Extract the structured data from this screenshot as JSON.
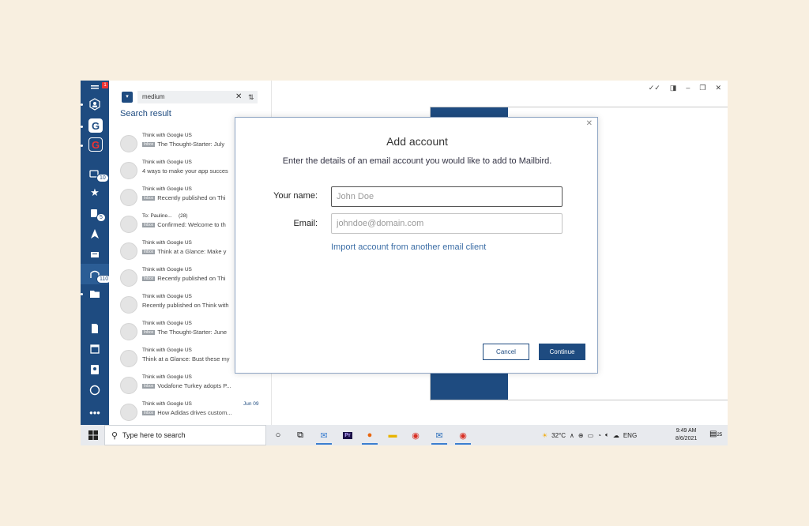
{
  "rail": {
    "notification_badge": "1",
    "badge_1": "10",
    "badge_2": "5",
    "badge_3": "110"
  },
  "search": {
    "query": "medium",
    "title": "Search result",
    "results": [
      {
        "sender": "Think with Google US",
        "tag": "Inbox",
        "subject": "The Thought-Starter: July",
        "count": "",
        "date": ""
      },
      {
        "sender": "Think with Google US",
        "tag": "",
        "subject": "4 ways to make your app succes",
        "count": "",
        "date": ""
      },
      {
        "sender": "Think with Google US",
        "tag": "Inbox",
        "subject": "Recently published on Thi",
        "count": "",
        "date": ""
      },
      {
        "sender": "To: Pauline...",
        "tag": "Inbox",
        "subject": "Confirmed: Welcome to th",
        "count": "(28)",
        "date": ""
      },
      {
        "sender": "Think with Google US",
        "tag": "Inbox",
        "subject": "Think at a Glance: Make y",
        "count": "",
        "date": ""
      },
      {
        "sender": "Think with Google US",
        "tag": "Inbox",
        "subject": "Recently published on Thi",
        "count": "",
        "date": ""
      },
      {
        "sender": "Think with Google US",
        "tag": "",
        "subject": "Recently published on Think with",
        "count": "",
        "date": ""
      },
      {
        "sender": "Think with Google US",
        "tag": "Inbox",
        "subject": "The Thought-Starter: June",
        "count": "",
        "date": ""
      },
      {
        "sender": "Think with Google US",
        "tag": "",
        "subject": "Think at a Glance: Bust these my",
        "count": "",
        "date": ""
      },
      {
        "sender": "Think with Google US",
        "tag": "Inbox",
        "subject": "Vodafone Turkey adopts P...",
        "count": "",
        "date": ""
      },
      {
        "sender": "Think with Google US",
        "tag": "Inbox",
        "subject": "How Adidas drives custom...",
        "count": "",
        "date": "Jun 09"
      }
    ]
  },
  "dialog": {
    "title": "Add account",
    "subtitle": "Enter the details of an email account you would like to add to Mailbird.",
    "name_label": "Your name:",
    "name_placeholder": "John Doe",
    "email_label": "Email:",
    "email_placeholder": "johndoe@domain.com",
    "import_link": "Import account from another email client",
    "cancel_label": "Cancel",
    "continue_label": "Continue"
  },
  "taskbar": {
    "search_placeholder": "Type here to search",
    "temperature": "32°C",
    "language": "ENG",
    "time": "9:49 AM",
    "date": "8/6/2021",
    "notification_count": "25"
  },
  "colors": {
    "brand": "#1e4b80",
    "link": "#3c6ea6",
    "background": "#f8efe0"
  }
}
